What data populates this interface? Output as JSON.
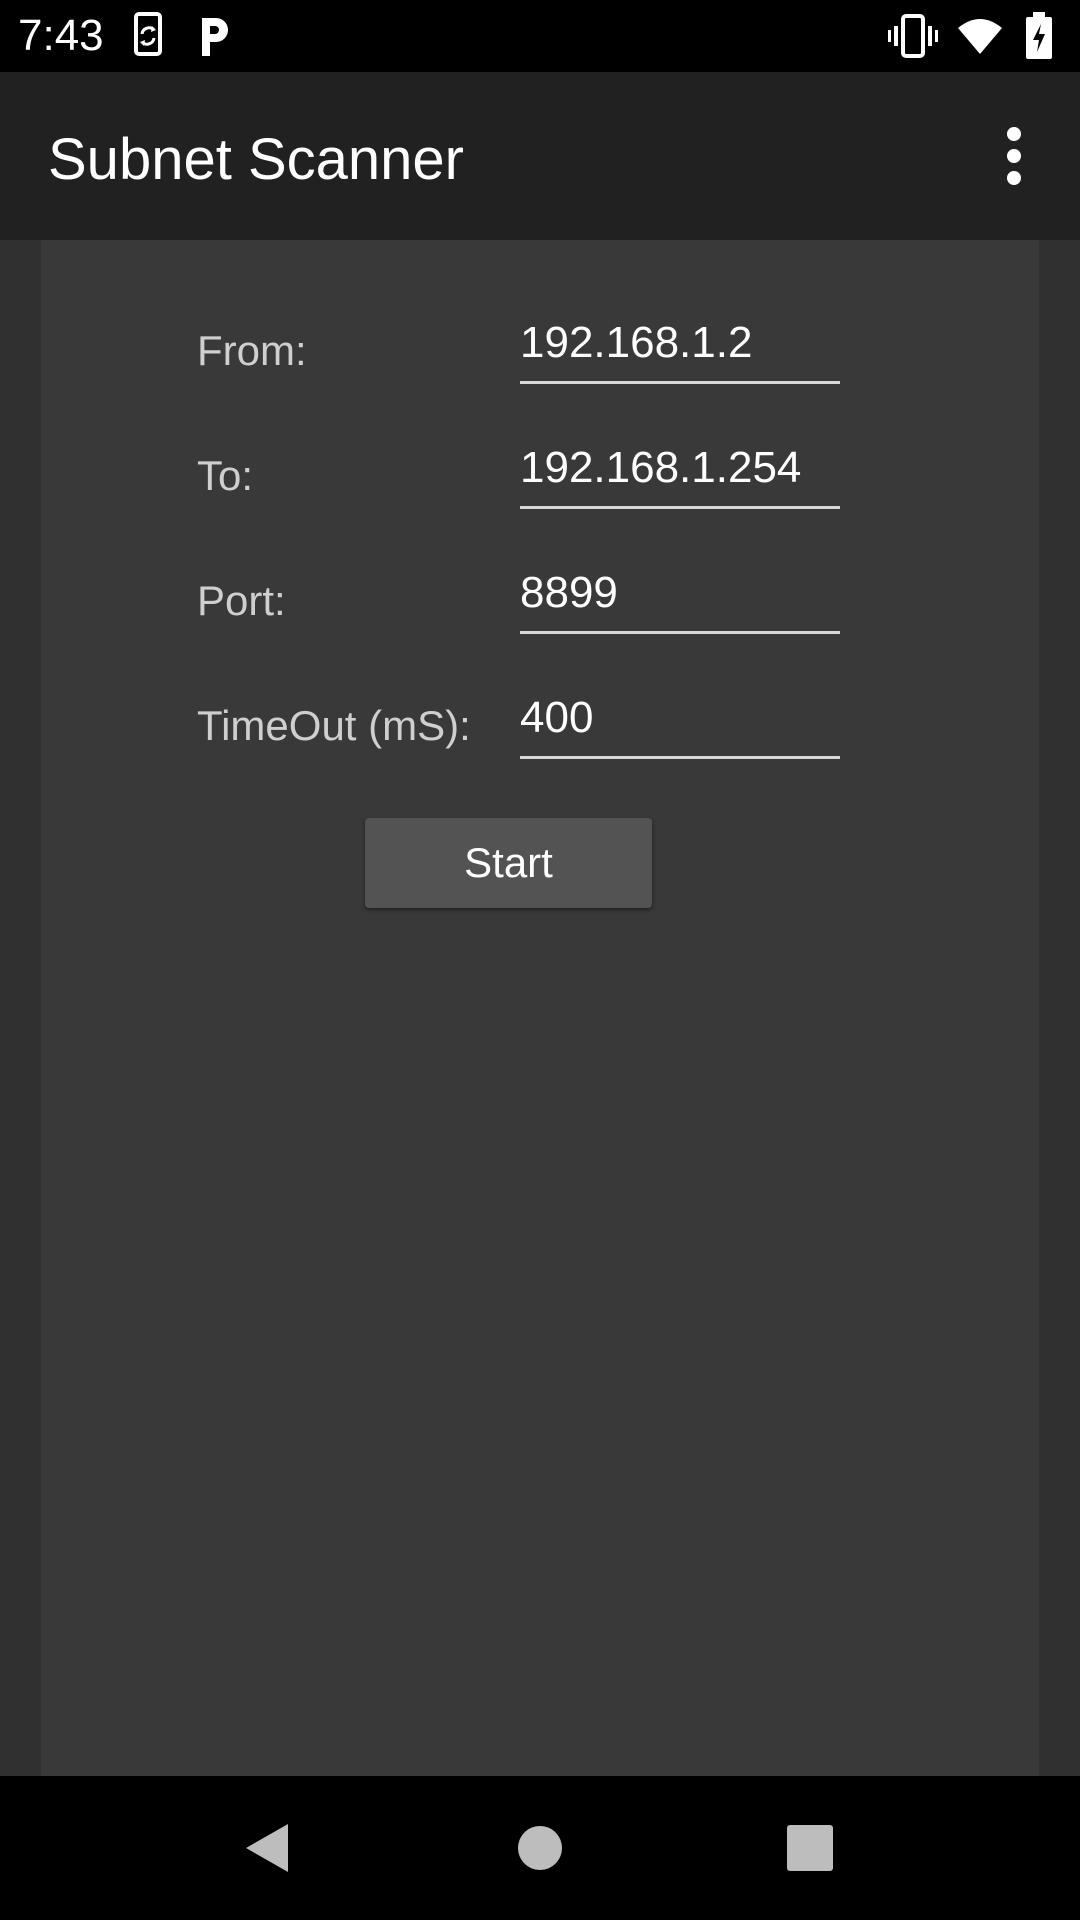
{
  "status_bar": {
    "time": "7:43",
    "left_icons": [
      "screen-rotate-icon",
      "parking-p-icon"
    ],
    "right_icons": [
      "vibrate-icon",
      "wifi-icon",
      "battery-charging-icon"
    ]
  },
  "app_bar": {
    "title": "Subnet Scanner",
    "menu_icon": "overflow-menu-icon"
  },
  "form": {
    "from_label": "From:",
    "from_value": "192.168.1.2",
    "to_label": "To:",
    "to_value": "192.168.1.254",
    "port_label": "Port:",
    "port_value": "8899",
    "timeout_label": "TimeOut (mS):",
    "timeout_value": "400",
    "start_label": "Start"
  },
  "nav_bar": {
    "icons": [
      "back-icon",
      "home-icon",
      "recents-icon"
    ]
  },
  "colors": {
    "status_bar": "#000000",
    "app_bar": "#212121",
    "background": "#303030",
    "panel": "#393939",
    "button": "#535353",
    "text_primary": "#ffffff",
    "text_label": "#cfcfcf"
  }
}
